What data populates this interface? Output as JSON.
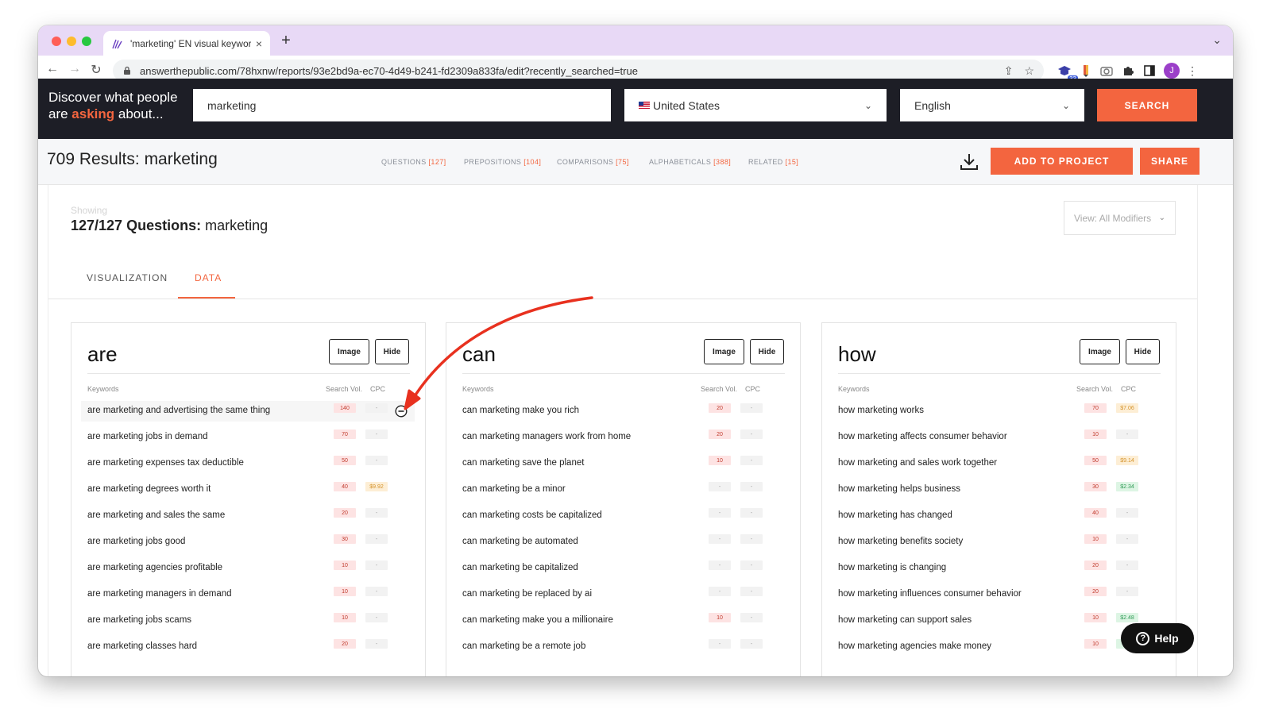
{
  "browser": {
    "tab_title": "'marketing' EN visual keyword",
    "tab_close": "×",
    "new_tab": "+",
    "tab_menu": "⌄",
    "url": "answerthepublic.com/78hxnw/reports/93e2bd9a-ec70-4d49-b241-fd2309a833fa/edit?recently_searched=true",
    "extension_badge": "33",
    "profile_initial": "J"
  },
  "header": {
    "tagline_line1": "Discover what people",
    "tagline_pre": "are ",
    "tagline_highlight": "asking",
    "tagline_post": " about...",
    "search_value": "marketing",
    "country": "United States",
    "language": "English",
    "search_button": "SEARCH"
  },
  "results": {
    "title": "709 Results: marketing",
    "tabs": [
      {
        "label": "QUESTIONS",
        "count": "[127]"
      },
      {
        "label": "PREPOSITIONS",
        "count": "[104]"
      },
      {
        "label": "COMPARISONS",
        "count": "[75]"
      },
      {
        "label": "ALPHABETICALS",
        "count": "[388]"
      },
      {
        "label": "RELATED",
        "count": "[15]"
      }
    ],
    "add_to_project": "ADD TO PROJECT",
    "share": "SHARE"
  },
  "panel": {
    "showing": "Showing",
    "questions_bold": "127/127 Questions:",
    "questions_term": " marketing",
    "view_modifiers": "View: All Modifiers",
    "tab_visualization": "VISUALIZATION",
    "tab_data": "DATA"
  },
  "cards": [
    {
      "title": "are",
      "image_btn": "Image",
      "hide_btn": "Hide",
      "col_keywords": "Keywords",
      "col_vol": "Search Vol.",
      "col_cpc": "CPC",
      "rows": [
        {
          "kw": "are marketing and advertising the same thing",
          "vol": "140",
          "cpc": "-"
        },
        {
          "kw": "are marketing jobs in demand",
          "vol": "70",
          "cpc": "-"
        },
        {
          "kw": "are marketing expenses tax deductible",
          "vol": "50",
          "cpc": "-"
        },
        {
          "kw": "are marketing degrees worth it",
          "vol": "40",
          "cpc": "$9.92"
        },
        {
          "kw": "are marketing and sales the same",
          "vol": "20",
          "cpc": "-"
        },
        {
          "kw": "are marketing jobs good",
          "vol": "30",
          "cpc": "-"
        },
        {
          "kw": "are marketing agencies profitable",
          "vol": "10",
          "cpc": "-"
        },
        {
          "kw": "are marketing managers in demand",
          "vol": "10",
          "cpc": "-"
        },
        {
          "kw": "are marketing jobs scams",
          "vol": "10",
          "cpc": "-"
        },
        {
          "kw": "are marketing classes hard",
          "vol": "20",
          "cpc": "-"
        }
      ]
    },
    {
      "title": "can",
      "image_btn": "Image",
      "hide_btn": "Hide",
      "col_keywords": "Keywords",
      "col_vol": "Search Vol.",
      "col_cpc": "CPC",
      "rows": [
        {
          "kw": "can marketing make you rich",
          "vol": "20",
          "cpc": "-"
        },
        {
          "kw": "can marketing managers work from home",
          "vol": "20",
          "cpc": "-"
        },
        {
          "kw": "can marketing save the planet",
          "vol": "10",
          "cpc": "-"
        },
        {
          "kw": "can marketing be a minor",
          "vol": "-",
          "cpc": "-"
        },
        {
          "kw": "can marketing costs be capitalized",
          "vol": "-",
          "cpc": "-"
        },
        {
          "kw": "can marketing be automated",
          "vol": "-",
          "cpc": "-"
        },
        {
          "kw": "can marketing be capitalized",
          "vol": "-",
          "cpc": "-"
        },
        {
          "kw": "can marketing be replaced by ai",
          "vol": "-",
          "cpc": "-"
        },
        {
          "kw": "can marketing make you a millionaire",
          "vol": "10",
          "cpc": "-"
        },
        {
          "kw": "can marketing be a remote job",
          "vol": "-",
          "cpc": "-"
        }
      ]
    },
    {
      "title": "how",
      "image_btn": "Image",
      "hide_btn": "Hide",
      "col_keywords": "Keywords",
      "col_vol": "Search Vol.",
      "col_cpc": "CPC",
      "rows": [
        {
          "kw": "how marketing works",
          "vol": "70",
          "cpc": "$7.06"
        },
        {
          "kw": "how marketing affects consumer behavior",
          "vol": "10",
          "cpc": "-"
        },
        {
          "kw": "how marketing and sales work together",
          "vol": "50",
          "cpc": "$9.14"
        },
        {
          "kw": "how marketing helps business",
          "vol": "30",
          "cpc": "$2.34"
        },
        {
          "kw": "how marketing has changed",
          "vol": "40",
          "cpc": "-"
        },
        {
          "kw": "how marketing benefits society",
          "vol": "10",
          "cpc": "-"
        },
        {
          "kw": "how marketing is changing",
          "vol": "20",
          "cpc": "-"
        },
        {
          "kw": "how marketing influences consumer behavior",
          "vol": "20",
          "cpc": "-"
        },
        {
          "kw": "how marketing can support sales",
          "vol": "10",
          "cpc": "$2.48"
        },
        {
          "kw": "how marketing agencies make money",
          "vol": "10",
          "cpc": ""
        }
      ]
    }
  ],
  "help": "Help",
  "colors": {
    "accent": "#f3653f",
    "header_bg": "#1d1e26",
    "tab_strip": "#e8d9f6",
    "annotation_arrow": "#e8311f"
  }
}
